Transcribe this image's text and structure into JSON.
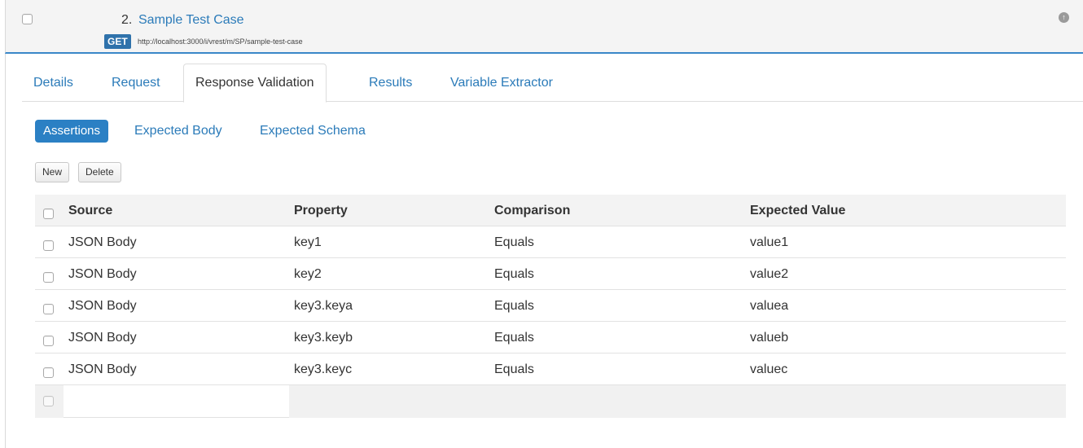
{
  "test_case": {
    "number": "2.",
    "title": "Sample Test Case",
    "method": "GET",
    "url": "http://localhost:3000/i/vrest/m/SP/sample-test-case"
  },
  "tabs": [
    {
      "label": "Details",
      "active": false
    },
    {
      "label": "Request",
      "active": false
    },
    {
      "label": "Response Validation",
      "active": true
    },
    {
      "label": "Results",
      "active": false
    },
    {
      "label": "Variable Extractor",
      "active": false
    }
  ],
  "pills": [
    {
      "label": "Assertions",
      "active": true
    },
    {
      "label": "Expected Body",
      "active": false
    },
    {
      "label": "Expected Schema",
      "active": false
    }
  ],
  "buttons": {
    "new_label": "New",
    "delete_label": "Delete"
  },
  "table": {
    "columns": [
      "Source",
      "Property",
      "Comparison",
      "Expected Value"
    ],
    "rows": [
      [
        "JSON Body",
        "key1",
        "Equals",
        "value1"
      ],
      [
        "JSON Body",
        "key2",
        "Equals",
        "value2"
      ],
      [
        "JSON Body",
        "key3.keya",
        "Equals",
        "valuea"
      ],
      [
        "JSON Body",
        "key3.keyb",
        "Equals",
        "valueb"
      ],
      [
        "JSON Body",
        "key3.keyc",
        "Equals",
        "valuec"
      ]
    ]
  },
  "colors": {
    "accent": "#2b80c4",
    "link": "#2b7bb9",
    "header_bg": "#f4f4f4"
  }
}
